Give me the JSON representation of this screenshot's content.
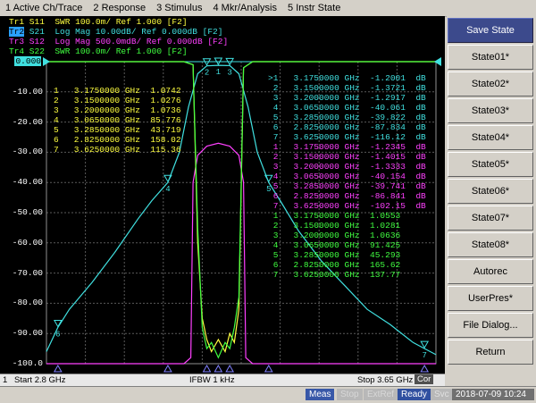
{
  "menu": [
    "1 Active Ch/Trace",
    "2 Response",
    "3 Stimulus",
    "4 Mkr/Analysis",
    "5 Instr State"
  ],
  "traces": [
    {
      "tag": "Tr1",
      "text": " S11  SWR 100.0m/ Ref 1.000 [F2]",
      "color": "#ffff40"
    },
    {
      "tag": "Tr2",
      "text": " S21  Log Mag 10.00dB/ Ref 0.000dB [F2]",
      "color": "#40e0e0"
    },
    {
      "tag": "Tr3",
      "text": " S12  Log Mag 500.0mdB/ Ref 0.000dB [F2]",
      "color": "#ff40ff"
    },
    {
      "tag": "Tr4",
      "text": " S22  SWR 100.0m/ Ref 1.000 [F2]",
      "color": "#40ff40"
    }
  ],
  "active_tag": "Tr2",
  "ref_value": "0.000",
  "y_axis": [
    "0.000",
    "-10.00",
    "-20.00",
    "-30.00",
    "-40.00",
    "-50.00",
    "-60.00",
    "-70.00",
    "-80.00",
    "-90.00",
    "-100.0"
  ],
  "marker_table_s11": [
    "1   3.1750000 GHz  1.0742",
    "2   3.1500000 GHz  1.0276",
    "3   3.2000000 GHz  1.0736",
    "4   3.0650000 GHz  85.776",
    "5   3.2850000 GHz  43.719",
    "6   2.8250000 GHz  158.02",
    "7   3.6250000 GHz  115.36"
  ],
  "marker_table_s21": [
    ">1   3.1750000 GHz  -1.2001  dB",
    " 2   3.1500000 GHz  -1.3721  dB",
    " 3   3.2000000 GHz  -1.2917  dB",
    " 4   3.0650000 GHz  -40.061  dB",
    " 5   3.2850000 GHz  -39.822  dB",
    " 6   2.8250000 GHz  -87.834  dB",
    " 7   3.6250000 GHz  -116.12  dB"
  ],
  "marker_table_s12": [
    " 1   3.1750000 GHz  -1.2345  dB",
    " 2   3.1500000 GHz  -1.4015  dB",
    " 3   3.2000000 GHz  -1.3333  dB",
    " 4   3.0650000 GHz  -40.154  dB",
    " 5   3.2850000 GHz  -39.741  dB",
    " 6   2.8250000 GHz  -86.841  dB",
    " 7   3.6250000 GHz  -102.15  dB"
  ],
  "marker_table_s22": [
    " 1   3.1750000 GHz  1.0553",
    " 2   3.1500000 GHz  1.0281",
    " 3   3.2000000 GHz  1.0636",
    " 4   3.0650000 GHz  91.425",
    " 5   3.2850000 GHz  45.293",
    " 6   2.8250000 GHz  165.62",
    " 7   3.6250000 GHz  137.77"
  ],
  "softkeys": {
    "title": "Save State",
    "items": [
      "State01*",
      "State02*",
      "State03*",
      "State04*",
      "State05*",
      "State06*",
      "State07*",
      "State08*",
      "Autorec",
      "UserPres*",
      "File Dialog...",
      "Return"
    ]
  },
  "bottom": {
    "channel": "1",
    "start": "Start 2.8 GHz",
    "ifbw": "IFBW 1 kHz",
    "stop": "Stop 3.65 GHz",
    "cor": "Cor"
  },
  "status": {
    "meas": "Meas",
    "stop": "Stop",
    "extref": "ExtRef",
    "ready": "Ready",
    "svc": "Svc",
    "datetime": "2018-07-09 10:24"
  },
  "chart_data": {
    "type": "line",
    "x_range_ghz": [
      2.8,
      3.65
    ],
    "ylim": [
      -100,
      0
    ],
    "y_ticks": [
      0,
      -10,
      -20,
      -30,
      -40,
      -50,
      -60,
      -70,
      -80,
      -90,
      -100
    ],
    "grid": true,
    "series": [
      {
        "name": "S21",
        "color": "#40e0e0",
        "x": [
          2.8,
          2.825,
          2.85,
          2.9,
          2.95,
          3.0,
          3.03,
          3.065,
          3.09,
          3.11,
          3.13,
          3.15,
          3.175,
          3.2,
          3.22,
          3.24,
          3.26,
          3.285,
          3.31,
          3.35,
          3.4,
          3.45,
          3.5,
          3.55,
          3.6,
          3.625,
          3.65
        ],
        "y": [
          -96,
          -88,
          -82,
          -73,
          -63,
          -52,
          -46,
          -40,
          -30,
          -15,
          -4,
          -1.4,
          -1.2,
          -1.3,
          -4,
          -15,
          -30,
          -40,
          -46,
          -56,
          -66,
          -74,
          -82,
          -87,
          -93,
          -95,
          -97
        ]
      },
      {
        "name": "S12",
        "color": "#ff40ff",
        "x": [
          2.8,
          3.1,
          3.115,
          3.12,
          3.13,
          3.15,
          3.175,
          3.2,
          3.22,
          3.23,
          3.235,
          3.25,
          3.65
        ],
        "y": [
          -100,
          -100,
          -98,
          -40,
          -31,
          -28,
          -27,
          -28,
          -31,
          -40,
          -98,
          -100,
          -100
        ]
      },
      {
        "name": "S11",
        "color": "#ffff40",
        "x": [
          2.8,
          3.1,
          3.12,
          3.13,
          3.14,
          3.15,
          3.16,
          3.175,
          3.19,
          3.2,
          3.21,
          3.22,
          3.23,
          3.25,
          3.65
        ],
        "y": [
          0,
          0,
          -1,
          -60,
          -85,
          -92,
          -96,
          -92,
          -96,
          -90,
          -93,
          -82,
          -2,
          0,
          0
        ]
      },
      {
        "name": "S22",
        "color": "#40ff40",
        "x": [
          2.8,
          3.1,
          3.12,
          3.13,
          3.14,
          3.15,
          3.16,
          3.175,
          3.19,
          3.2,
          3.21,
          3.22,
          3.23,
          3.25,
          3.65
        ],
        "y": [
          0,
          0,
          -1,
          -55,
          -88,
          -95,
          -93,
          -98,
          -93,
          -95,
          -88,
          -78,
          -2,
          0,
          0
        ]
      }
    ],
    "markers": [
      {
        "id": "1",
        "x": 3.175
      },
      {
        "id": "2",
        "x": 3.15
      },
      {
        "id": "3",
        "x": 3.2
      },
      {
        "id": "4",
        "x": 3.065
      },
      {
        "id": "5",
        "x": 3.285
      },
      {
        "id": "6",
        "x": 2.825
      },
      {
        "id": "7",
        "x": 3.625
      }
    ]
  }
}
